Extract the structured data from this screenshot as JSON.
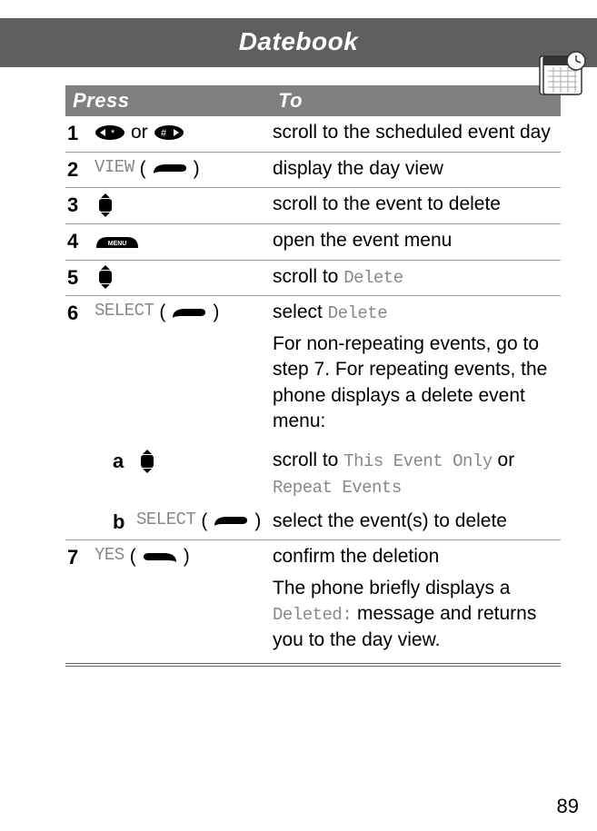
{
  "header": {
    "title": "Datebook"
  },
  "table": {
    "head": {
      "press": "Press",
      "to": "To"
    },
    "rows": [
      {
        "num": "1",
        "press_text_mid": "or",
        "to": "scroll to the scheduled event day"
      },
      {
        "num": "2",
        "soft_label": "VIEW",
        "to": "display the day view"
      },
      {
        "num": "3",
        "to": "scroll to the event to delete"
      },
      {
        "num": "4",
        "to": "open the event menu"
      },
      {
        "num": "5",
        "to_pre": "scroll to ",
        "to_code": "Delete"
      },
      {
        "num": "6",
        "soft_label": "SELECT",
        "to_pre": "select ",
        "to_code": "Delete",
        "extra": "For non-repeating events, go to step 7. For repeating events, the phone displays a delete event menu:",
        "subs": [
          {
            "letter": "a",
            "to_pre": "scroll to ",
            "to_code1": "This Event Only",
            "to_mid": " or ",
            "to_code2": "Repeat Events"
          },
          {
            "letter": "b",
            "soft_label": "SELECT",
            "to": "select the event(s) to delete"
          }
        ]
      },
      {
        "num": "7",
        "soft_label": "YES",
        "to": "confirm the deletion",
        "extra_pre": "The phone briefly displays a ",
        "extra_code": "Deleted:",
        "extra_post": " message and returns you to the day view."
      }
    ]
  },
  "page_number": "89"
}
